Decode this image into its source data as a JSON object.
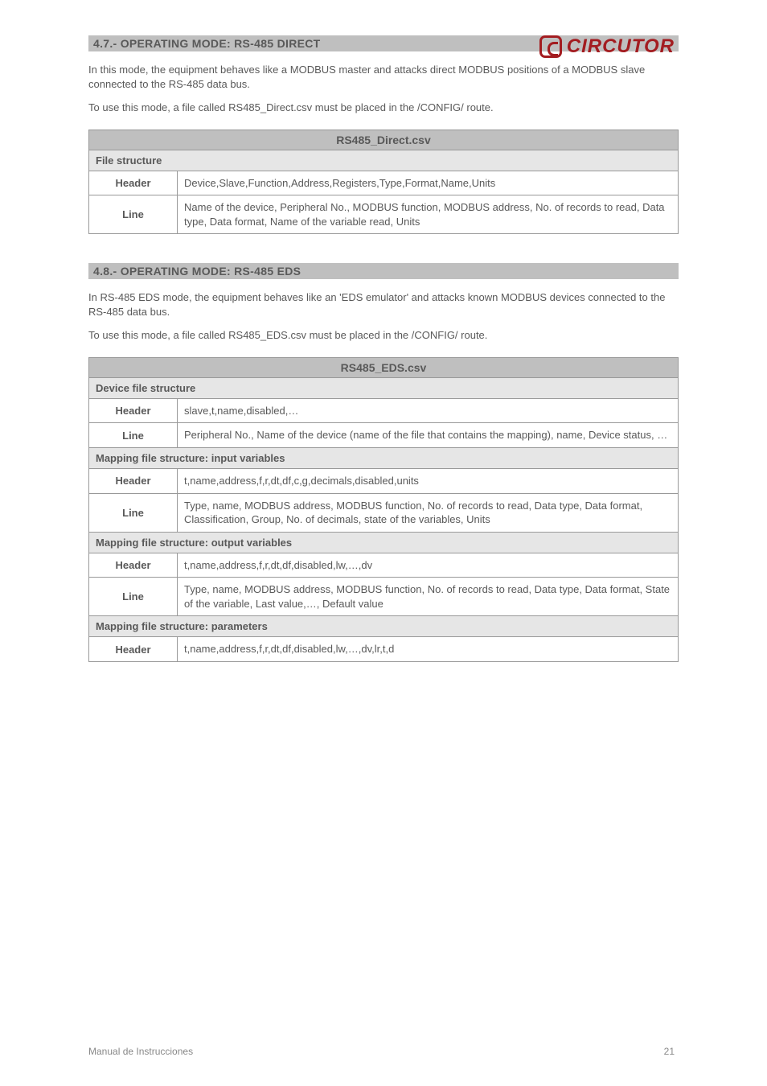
{
  "logo_text": "CIRCUTOR",
  "section_a": {
    "heading": "4.7.- OPERATING MODE: RS-485 DIRECT",
    "p1": "In this mode, the equipment behaves like a MODBUS master and attacks direct MODBUS positions of a MODBUS slave connected to the RS-485 data bus.",
    "p2": "To use this mode, a file called RS485_Direct.csv must be placed in the /CONFIG/ route.",
    "table_title": "RS485_Direct.csv",
    "table_sub": "File structure",
    "rows": [
      {
        "key": "Header",
        "val": "Device,Slave,Function,Address,Registers,Type,Format,Name,Units"
      },
      {
        "key": "Line",
        "val": "Name of the device, Peripheral No., MODBUS function, MODBUS address, No. of records to read, Data type, Data format, Name of the variable read, Units"
      }
    ]
  },
  "section_b": {
    "heading": "4.8.- OPERATING MODE: RS-485 EDS",
    "p1": "In RS-485 EDS mode, the equipment behaves like an 'EDS emulator' and attacks known MODBUS devices connected to the RS-485 data bus.",
    "p2": "To use this mode, a file called RS485_EDS.csv must be placed in the /CONFIG/ route.",
    "table_title": "RS485_EDS.csv",
    "table_sub_devices": "Device file structure",
    "rows_devices": [
      {
        "key": "Header",
        "val": "slave,t,name,disabled,…"
      },
      {
        "key": "Line",
        "val": "Peripheral No., Name of the device (name of the file that contains the mapping), name, Device status, …"
      }
    ],
    "table_sub_t1": "Mapping file structure: input variables",
    "rows_t1": [
      {
        "key": "Header",
        "val": "t,name,address,f,r,dt,df,c,g,decimals,disabled,units"
      },
      {
        "key": "Line",
        "val": "Type, name, MODBUS address, MODBUS function, No. of records to read, Data type, Data format, Classification, Group, No. of decimals, state of the variables, Units"
      }
    ],
    "table_sub_t2": "Mapping file structure: output variables",
    "rows_t2": [
      {
        "key": "Header",
        "val": "t,name,address,f,r,dt,df,disabled,lw,…,dv"
      },
      {
        "key": "Line",
        "val": "Type, name, MODBUS address, MODBUS function, No. of records to read, Data type, Data format, State of the variable, Last value,…, Default value"
      }
    ],
    "table_sub_t3": "Mapping file structure: parameters",
    "rows_t3": [
      {
        "key": "Header",
        "val": "t,name,address,f,r,dt,df,disabled,lw,…,dv,lr,t,d"
      }
    ]
  },
  "footer": {
    "manual": "Manual de Instrucciones",
    "page": "21"
  }
}
